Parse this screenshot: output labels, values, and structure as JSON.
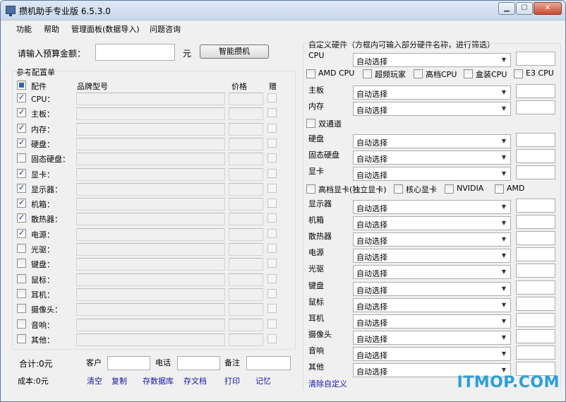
{
  "window": {
    "title": "攒机助手专业版 6.5.3.0",
    "controls": [
      "minimize",
      "maximize",
      "close"
    ]
  },
  "menu": [
    "功能",
    "帮助",
    "管理面板(数据导入)",
    "问题咨询"
  ],
  "budget": {
    "label": "请输入预算金额：",
    "value": "",
    "unit": "元",
    "button": "智能攒机"
  },
  "config": {
    "group_title": "参考配置单",
    "headers": {
      "part": "配件",
      "model": "品牌型号",
      "price": "价格",
      "gift": "赠"
    },
    "rows": [
      {
        "label": "CPU：",
        "checked": true
      },
      {
        "label": "主板：",
        "checked": true
      },
      {
        "label": "内存：",
        "checked": true
      },
      {
        "label": "硬盘：",
        "checked": true
      },
      {
        "label": "固态硬盘：",
        "checked": false
      },
      {
        "label": "显卡：",
        "checked": true
      },
      {
        "label": "显示器：",
        "checked": true
      },
      {
        "label": "机箱：",
        "checked": true
      },
      {
        "label": "散热器：",
        "checked": true
      },
      {
        "label": "电源：",
        "checked": true
      },
      {
        "label": "光驱：",
        "checked": false
      },
      {
        "label": "键盘：",
        "checked": false
      },
      {
        "label": "鼠标：",
        "checked": false
      },
      {
        "label": "耳机：",
        "checked": false
      },
      {
        "label": "摄像头：",
        "checked": false
      },
      {
        "label": "音响：",
        "checked": false
      },
      {
        "label": "其他：",
        "checked": false
      }
    ]
  },
  "footer": {
    "total": "合计:0元",
    "cost": "成本:0元",
    "customer_label": "客户",
    "phone_label": "电话",
    "note_label": "备注",
    "links": [
      "清空",
      "复制",
      "存数据库",
      "存文档",
      "打印",
      "记忆"
    ]
  },
  "custom": {
    "title": "自定义硬件（方框内可输入部分硬件名称，进行筛选）",
    "select_value": "自动选择",
    "cpu_label": "CPU",
    "cpu_filters": [
      "AMD CPU",
      "超频玩家",
      "高档CPU",
      "盒装CPU",
      "E3 CPU"
    ],
    "mainboard_label": "主板",
    "memory_label": "内存",
    "dual_channel": "双通道",
    "disk_label": "硬盘",
    "ssd_label": "固态硬盘",
    "gpu_label": "显卡",
    "gpu_filters": [
      "高档显卡(独立显卡)",
      "核心显卡",
      "NVIDIA",
      "AMD"
    ],
    "rest": [
      "显示器",
      "机箱",
      "散热器",
      "电源",
      "光驱",
      "键盘",
      "鼠标",
      "耳机",
      "摄像头",
      "音响",
      "其他"
    ],
    "clear_link": "清除自定义"
  },
  "watermark": "ITMOP.COM"
}
